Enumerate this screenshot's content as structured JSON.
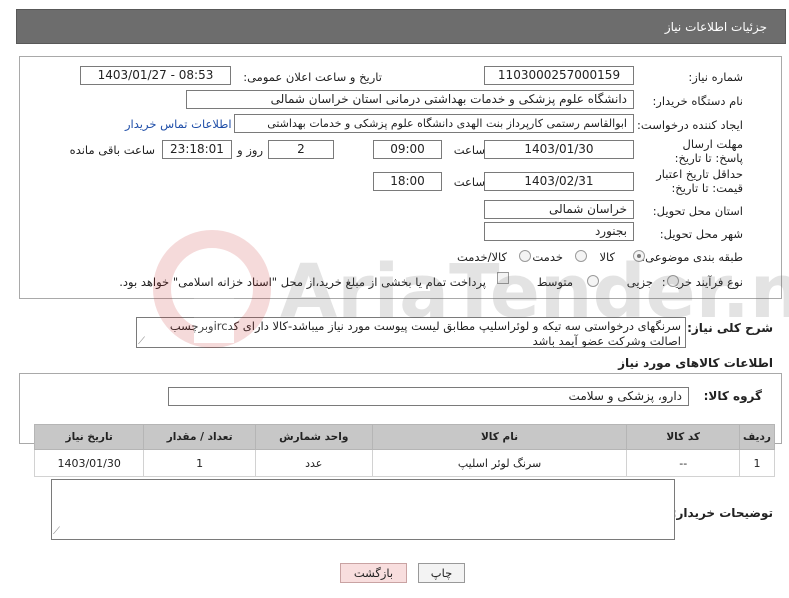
{
  "header": {
    "title": "جزئیات اطلاعات نیاز"
  },
  "labels": {
    "need_number": "شماره نیاز:",
    "announce_datetime": "تاریخ و ساعت اعلان عمومی:",
    "buyer_org": "نام دستگاه خریدار:",
    "requester": "ایجاد کننده درخواست:",
    "reply_deadline": "مهلت ارسال پاسخ: تا تاریخ:",
    "price_validity": "حداقل تاریخ اعتبار قیمت: تا تاریخ:",
    "time": "ساعت",
    "day_and": "روز و",
    "remaining": "ساعت باقی مانده",
    "province": "استان محل تحویل:",
    "city": "شهر محل تحویل:",
    "category": "طبقه بندی موضوعی:",
    "purchase_type": "نوع فرآیند خرید :",
    "description": "شرح کلی نیاز:",
    "goods_info": "اطلاعات کالاهای مورد نیاز",
    "goods_group": "گروه کالا:",
    "buyer_notes": "توضیحات خریدار:"
  },
  "fields": {
    "need_number": "1103000257000159",
    "announce_datetime": "1403/01/27 - 08:53",
    "buyer_org": "دانشگاه علوم پزشکی و خدمات بهداشتی درمانی استان خراسان شمالی",
    "requester": "ابوالقاسم رستمی کارپرداز بنت الهدی دانشگاه علوم پزشکی و خدمات بهداشتی",
    "contact_link": "اطلاعات تماس خریدار",
    "reply_date": "1403/01/30",
    "reply_time": "09:00",
    "reply_days": "2",
    "reply_remaining": "23:18:01",
    "validity_date": "1403/02/31",
    "validity_time": "18:00",
    "province": "خراسان شمالی",
    "city": "بجنورد",
    "description": "سرنگهای درخواستی سه تیکه و لوئراسلیپ مطابق لیست پیوست مورد نیاز میباشد-کالا دارای کدircوبرچسب اصالت وشرکت عضو آیمد باشد",
    "goods_group": "دارو، پزشکی و سلامت",
    "buyer_notes": ""
  },
  "category_options": [
    {
      "label": "کالا",
      "selected": true
    },
    {
      "label": "خدمت",
      "selected": false
    },
    {
      "label": "کالا/خدمت",
      "selected": false
    }
  ],
  "purchase_options": [
    {
      "label": "جزیی",
      "selected": false
    },
    {
      "label": "متوسط",
      "selected": false
    }
  ],
  "treasury_note": "پرداخت تمام یا بخشی از مبلغ خرید،از محل \"اسناد خزانه اسلامی\" خواهد بود.",
  "table": {
    "headers": [
      "ردیف",
      "کد کالا",
      "نام کالا",
      "واحد شمارش",
      "تعداد / مقدار",
      "تاریخ نیاز"
    ],
    "rows": [
      [
        "1",
        "--",
        "سرنگ لوئر اسلیپ",
        "عدد",
        "1",
        "1403/01/30"
      ]
    ]
  },
  "buttons": {
    "print": "چاپ",
    "back": "بازگشت"
  },
  "colors": {
    "header_bg": "#6d6d6d",
    "table_header_bg": "#c7c7c7",
    "link": "#1f4ea8",
    "back_btn_bg": "#f8dede"
  },
  "watermark": {
    "text": "AriaTender.net"
  }
}
